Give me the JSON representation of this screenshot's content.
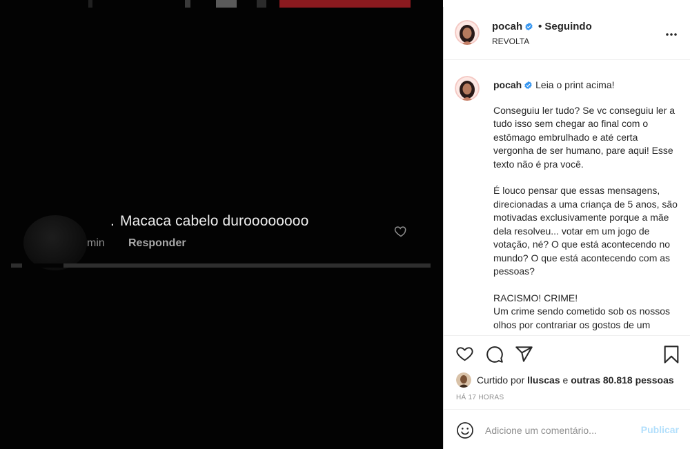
{
  "media": {
    "comment_text": "Macaca cabelo duroooooooo",
    "comment_time": "min",
    "reply_label": "Responder",
    "top_bar_colors": [
      "#202020",
      "#3a3a3a",
      "#5a5a5a",
      "#2b2b2b",
      "#8b1a1f",
      "#8b1a1f"
    ]
  },
  "post": {
    "username": "pocah",
    "follow_status": "• Seguindo",
    "location": "REVOLTA",
    "caption_first_line": "Leia o print acima!",
    "caption_paragraphs": [
      "Conseguiu ler tudo? Se vc conseguiu ler a tudo isso sem chegar ao final com o estômago embrulhado e até certa vergonha de ser humano, pare aqui! Esse texto não é pra você.",
      "É louco pensar que essas mensagens, direcionadas a uma criança de 5 anos, são motivadas exclusivamente porque a mãe dela resolveu... votar em um jogo de votação, né? O que está acontecendo no mundo? O que está acontecendo com as pessoas?",
      "RACISMO! CRIME!",
      "Um crime sendo cometido sob os nossos olhos por contrariar os gostos de um público de Reality show"
    ],
    "likes_prefix": "Curtido por",
    "likes_user": "lluscas",
    "likes_middle": "e",
    "likes_others": "outras 80.818 pessoas",
    "posted_ago": "HÁ 17 HORAS",
    "comment_placeholder": "Adicione um comentário...",
    "publish_label": "Publicar"
  },
  "icons": [
    "heart-icon",
    "comment-icon",
    "share-icon",
    "bookmark-icon",
    "emoji-icon",
    "more-icon",
    "verified-icon"
  ],
  "colors": {
    "verified": "#3897f0",
    "publish_disabled": "#b2dffc",
    "text": "#262626",
    "muted": "#8e8e8e"
  }
}
